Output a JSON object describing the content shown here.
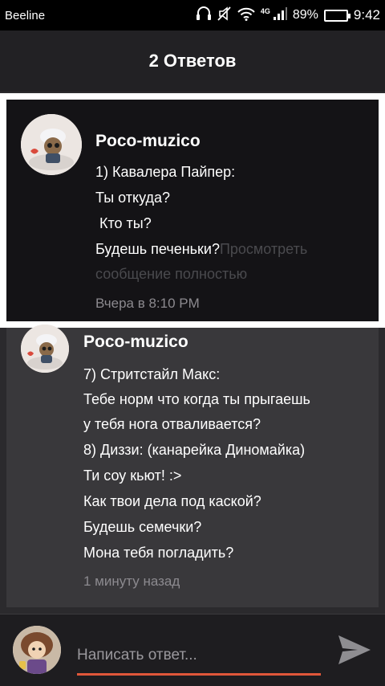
{
  "status_bar": {
    "carrier": "Beeline",
    "network": "4G",
    "battery": "89%",
    "battery_level": 0.89,
    "time": "9:42",
    "icons": [
      "headset-icon",
      "mute-icon",
      "wifi-icon",
      "signal-icon",
      "battery-icon"
    ]
  },
  "header": {
    "title": "2 Ответов"
  },
  "main_comment": {
    "author": "Poco-muzico",
    "lines": [
      "1) Кавалера Пайпер:",
      "Ты откуда?",
      " Кто ты?",
      "Будешь печеньки?"
    ],
    "more_link": [
      "Просмотреть",
      "сообщение полностью"
    ],
    "time": "Вчера в 8:10 PM"
  },
  "reply": {
    "author": "Poco-muzico",
    "lines": [
      "7) Стритстайл Макс:",
      "Тебе норм что когда ты прыгаешь",
      "у тебя нога отваливается?",
      "8) Диззи: (канарейка Диномайка)",
      "Ти соу кьют! :>",
      "Как твои дела под каской?",
      "Будешь семечки?",
      "Мона тебя погладить?"
    ],
    "time": "1 минуту назад"
  },
  "composer": {
    "placeholder": "Написать ответ...",
    "accent": "#e0573a"
  }
}
